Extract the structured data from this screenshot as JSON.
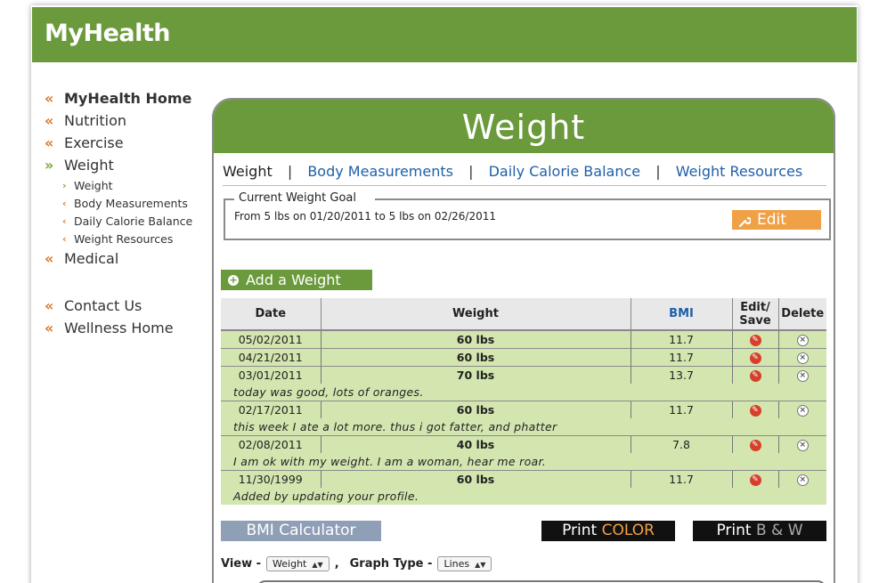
{
  "header": {
    "brand": "MyHealth"
  },
  "sidebar": {
    "items": [
      {
        "label": "MyHealth Home"
      },
      {
        "label": "Nutrition"
      },
      {
        "label": "Exercise"
      },
      {
        "label": "Weight"
      },
      {
        "label": "Medical"
      },
      {
        "label": "Contact Us"
      },
      {
        "label": "Wellness Home"
      }
    ],
    "sub_items": [
      {
        "label": "Weight"
      },
      {
        "label": "Body Measurements"
      },
      {
        "label": "Daily Calorie Balance"
      },
      {
        "label": "Weight Resources"
      }
    ]
  },
  "panel": {
    "title": "Weight",
    "tabs": [
      {
        "label": "Weight"
      },
      {
        "label": "Body Measurements"
      },
      {
        "label": "Daily Calorie Balance"
      },
      {
        "label": "Weight Resources"
      }
    ],
    "separator": "|"
  },
  "goal": {
    "legend": "Current Weight Goal",
    "text": "From 5 lbs on 01/20/2011 to 5 lbs on 02/26/2011",
    "edit_label": "Edit"
  },
  "add_weight_label": "Add a Weight",
  "table": {
    "headers": {
      "date": "Date",
      "weight": "Weight",
      "bmi": "BMI",
      "edit_line1": "Edit/",
      "edit_line2": "Save",
      "delete": "Delete"
    },
    "rows": [
      {
        "date": "05/02/2011",
        "weight": "60 lbs",
        "bmi": "11.7",
        "note": ""
      },
      {
        "date": "04/21/2011",
        "weight": "60 lbs",
        "bmi": "11.7",
        "note": ""
      },
      {
        "date": "03/01/2011",
        "weight": "70 lbs",
        "bmi": "13.7",
        "note": "today was good, lots of oranges."
      },
      {
        "date": "02/17/2011",
        "weight": "60 lbs",
        "bmi": "11.7",
        "note": "this week I ate a lot more. thus i got fatter, and phatter"
      },
      {
        "date": "02/08/2011",
        "weight": "40 lbs",
        "bmi": "7.8",
        "note": "I am ok with my weight. I am a woman, hear me roar."
      },
      {
        "date": "11/30/1999",
        "weight": "60 lbs",
        "bmi": "11.7",
        "note": "Added by updating your profile."
      }
    ]
  },
  "buttons": {
    "bmi_calculator": "BMI Calculator",
    "print_color_prefix": "Print",
    "print_color_accent": "COLOR",
    "print_bw_prefix": "Print",
    "print_bw_accent": "B & W"
  },
  "view_controls": {
    "view_label": "View -",
    "view_value": "Weight",
    "comma": ",",
    "graph_label": "Graph Type -",
    "graph_value": "Lines"
  },
  "colors": {
    "brand_green": "#6a9a3c",
    "row_green": "#d3e6b0",
    "accent_orange": "#f0a146",
    "link_blue": "#1f5fa8"
  }
}
